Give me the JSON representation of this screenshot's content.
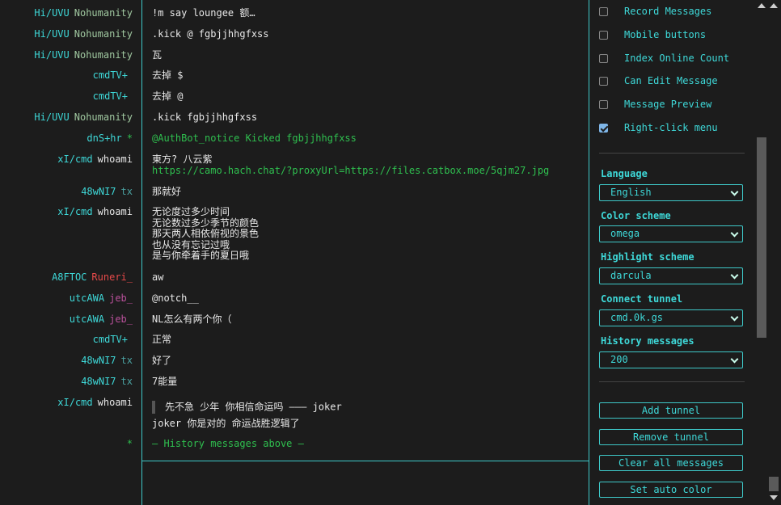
{
  "messages": [
    {
      "trip": "Hi/UVU",
      "name": "Nohumanity",
      "name_color": "#a0c8a0",
      "lines": [
        "!m say loungee 额…"
      ]
    },
    {
      "trip": "Hi/UVU",
      "name": "Nohumanity",
      "name_color": "#a0c8a0",
      "lines": [
        ".kick @ fgbjjhhgfxss"
      ]
    },
    {
      "trip": "Hi/UVU",
      "name": "Nohumanity",
      "name_color": "#a0c8a0",
      "lines": [
        "瓦"
      ]
    },
    {
      "trip": "cmdTV+",
      "name": "",
      "name_color": "#2a2a2a",
      "lines": [
        "去掉 $"
      ]
    },
    {
      "trip": "cmdTV+",
      "name": "",
      "name_color": "#2a2a2a",
      "lines": [
        "去掉 @"
      ]
    },
    {
      "trip": "Hi/UVU",
      "name": "Nohumanity",
      "name_color": "#a0c8a0",
      "lines": [
        ".kick fgbjjhhgfxss"
      ]
    },
    {
      "trip": "dnS+hr",
      "name": "*",
      "name_color": "#2fbf4f",
      "lines": [
        "@AuthBot_notice Kicked fgbjjhhgfxss"
      ],
      "style": "green"
    },
    {
      "trip": "xI/cmd",
      "name": "whoami",
      "name_color": "#e8e8e8",
      "lines": [
        "東方? 八云紫",
        "https://camo.hach.chat/?proxyUrl=https://files.catbox.moe/5qjm27.jpg"
      ]
    },
    {
      "trip": "48wNI7",
      "name": "tx",
      "name_color": "#4aa0a0",
      "lines": [
        "那就好"
      ]
    },
    {
      "trip": "xI/cmd",
      "name": "whoami",
      "name_color": "#e8e8e8",
      "lines": [
        "无论度过多少时间",
        "无论数过多少季节的颜色",
        "那天两人相依俯视的景色",
        "也从没有忘记过哦",
        "是与你牵着手的夏日哦"
      ]
    },
    {
      "trip": "A8FTOC",
      "name": "Runeri_",
      "name_color": "#e84a4a",
      "lines": [
        "aw"
      ]
    },
    {
      "trip": "utcAWA",
      "name": "jeb_",
      "name_color": "#b8509a",
      "lines": [
        "@notch__"
      ]
    },
    {
      "trip": "utcAWA",
      "name": "jeb_",
      "name_color": "#b8509a",
      "lines": [
        "NL怎么有两个你（"
      ]
    },
    {
      "trip": "cmdTV+",
      "name": "",
      "name_color": "#2a2a2a",
      "lines": [
        "正常"
      ]
    },
    {
      "trip": "48wNI7",
      "name": "tx",
      "name_color": "#4aa0a0",
      "lines": [
        "好了"
      ]
    },
    {
      "trip": "48wNI7",
      "name": "tx",
      "name_color": "#4aa0a0",
      "lines": [
        "7能量"
      ]
    },
    {
      "trip": "xI/cmd",
      "name": "whoami",
      "name_color": "#e8e8e8",
      "quote": "先不急 少年 你相信命运吗 ——— joker",
      "lines": [
        "joker 你是对的 命运战胜逻辑了"
      ]
    },
    {
      "trip": "",
      "name": "*",
      "name_color": "#2fbf4f",
      "lines": [
        "— History messages above —"
      ],
      "style": "green"
    }
  ],
  "settings": {
    "checkboxes": [
      {
        "label": "Record Messages",
        "checked": false
      },
      {
        "label": "Mobile buttons",
        "checked": false
      },
      {
        "label": "Index Online Count",
        "checked": false
      },
      {
        "label": "Can Edit Message",
        "checked": false
      },
      {
        "label": "Message Preview",
        "checked": false
      },
      {
        "label": "Right-click menu",
        "checked": true
      }
    ],
    "selects": [
      {
        "label": "Language",
        "value": "English"
      },
      {
        "label": "Color scheme",
        "value": "omega"
      },
      {
        "label": "Highlight scheme",
        "value": "darcula"
      },
      {
        "label": "Connect tunnel",
        "value": "cmd.0k.gs"
      },
      {
        "label": "History messages",
        "value": "200"
      }
    ],
    "buttons": [
      "Add tunnel",
      "Remove tunnel",
      "Clear all messages",
      "Set auto color"
    ]
  }
}
